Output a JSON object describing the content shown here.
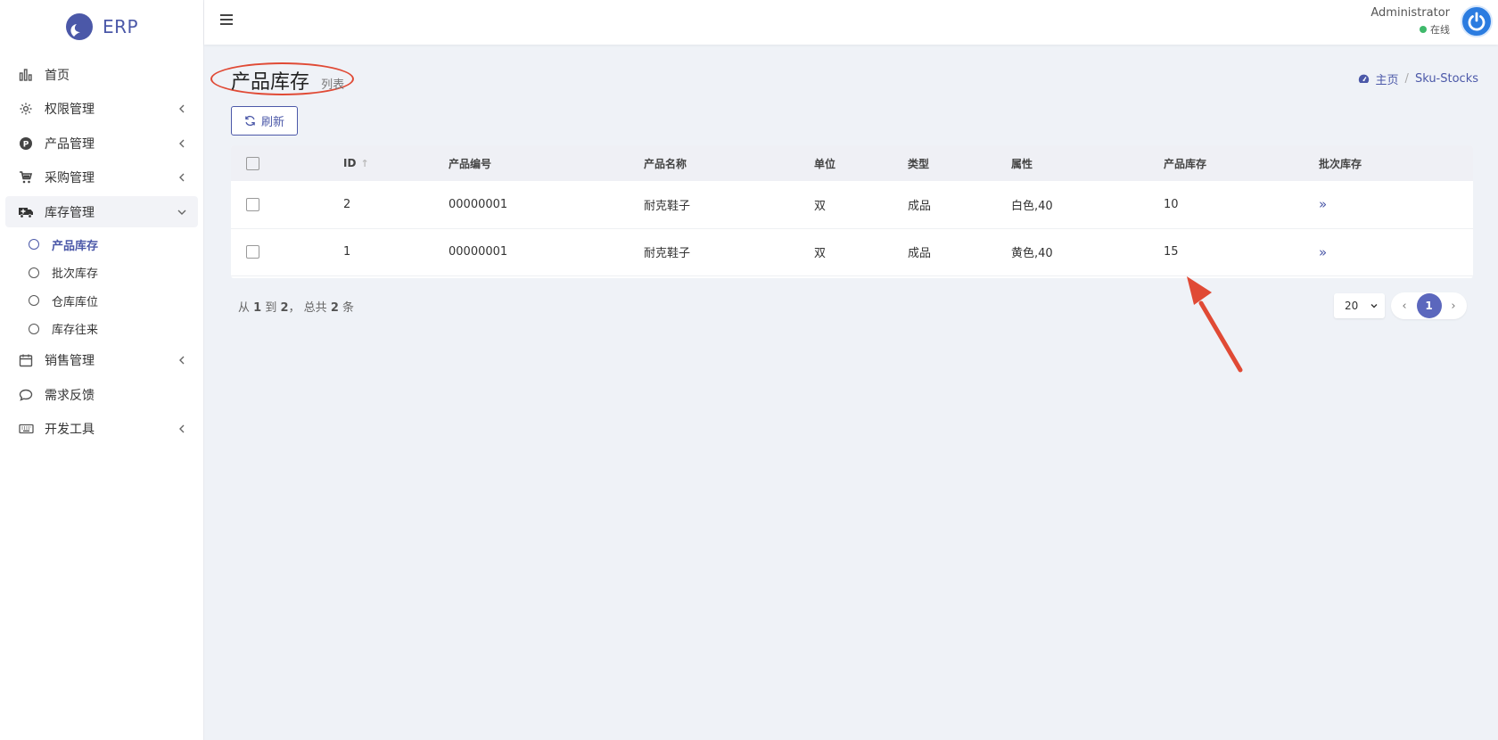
{
  "brand": {
    "name": "ERP"
  },
  "sidebar": {
    "items": [
      {
        "label": "首页",
        "icon": "bar-chart-icon"
      },
      {
        "label": "权限管理",
        "icon": "gear-icon",
        "has_children": true
      },
      {
        "label": "产品管理",
        "icon": "product-p-icon",
        "has_children": true
      },
      {
        "label": "采购管理",
        "icon": "cart-icon",
        "has_children": true
      },
      {
        "label": "库存管理",
        "icon": "truck-icon",
        "has_children": true,
        "open": true,
        "children": [
          {
            "label": "产品库存",
            "active": true
          },
          {
            "label": "批次库存"
          },
          {
            "label": "仓库库位"
          },
          {
            "label": "库存往来"
          }
        ]
      },
      {
        "label": "销售管理",
        "icon": "calendar-icon",
        "has_children": true
      },
      {
        "label": "需求反馈",
        "icon": "chat-bubble-icon"
      },
      {
        "label": "开发工具",
        "icon": "keyboard-icon",
        "has_children": true
      }
    ]
  },
  "topbar": {
    "user_name": "Administrator",
    "user_status": "在线"
  },
  "page": {
    "title": "产品库存",
    "subtitle": "列表"
  },
  "breadcrumb": {
    "home": "主页",
    "current": "Sku-Stocks"
  },
  "toolbar": {
    "refresh_label": "刷新"
  },
  "table": {
    "headers": [
      "ID",
      "产品编号",
      "产品名称",
      "单位",
      "类型",
      "属性",
      "产品库存",
      "批次库存"
    ],
    "rows": [
      {
        "id": "2",
        "code": "00000001",
        "name": "耐克鞋子",
        "unit": "双",
        "type": "成品",
        "attr": "白色,40",
        "stock": "10",
        "batch": "»"
      },
      {
        "id": "1",
        "code": "00000001",
        "name": "耐克鞋子",
        "unit": "双",
        "type": "成品",
        "attr": "黄色,40",
        "stock": "15",
        "batch": "»"
      }
    ]
  },
  "summary": {
    "prefix": "从",
    "from": "1",
    "mid": "到",
    "to": "2",
    "sep": "，  总共",
    "total": "2",
    "suffix": "条"
  },
  "pagination": {
    "page_size": "20",
    "current_page": "1",
    "prev": "‹",
    "next": "›"
  },
  "colors": {
    "accent": "#4b58a8",
    "annotation": "#e04a35",
    "online": "#3fb96b"
  }
}
